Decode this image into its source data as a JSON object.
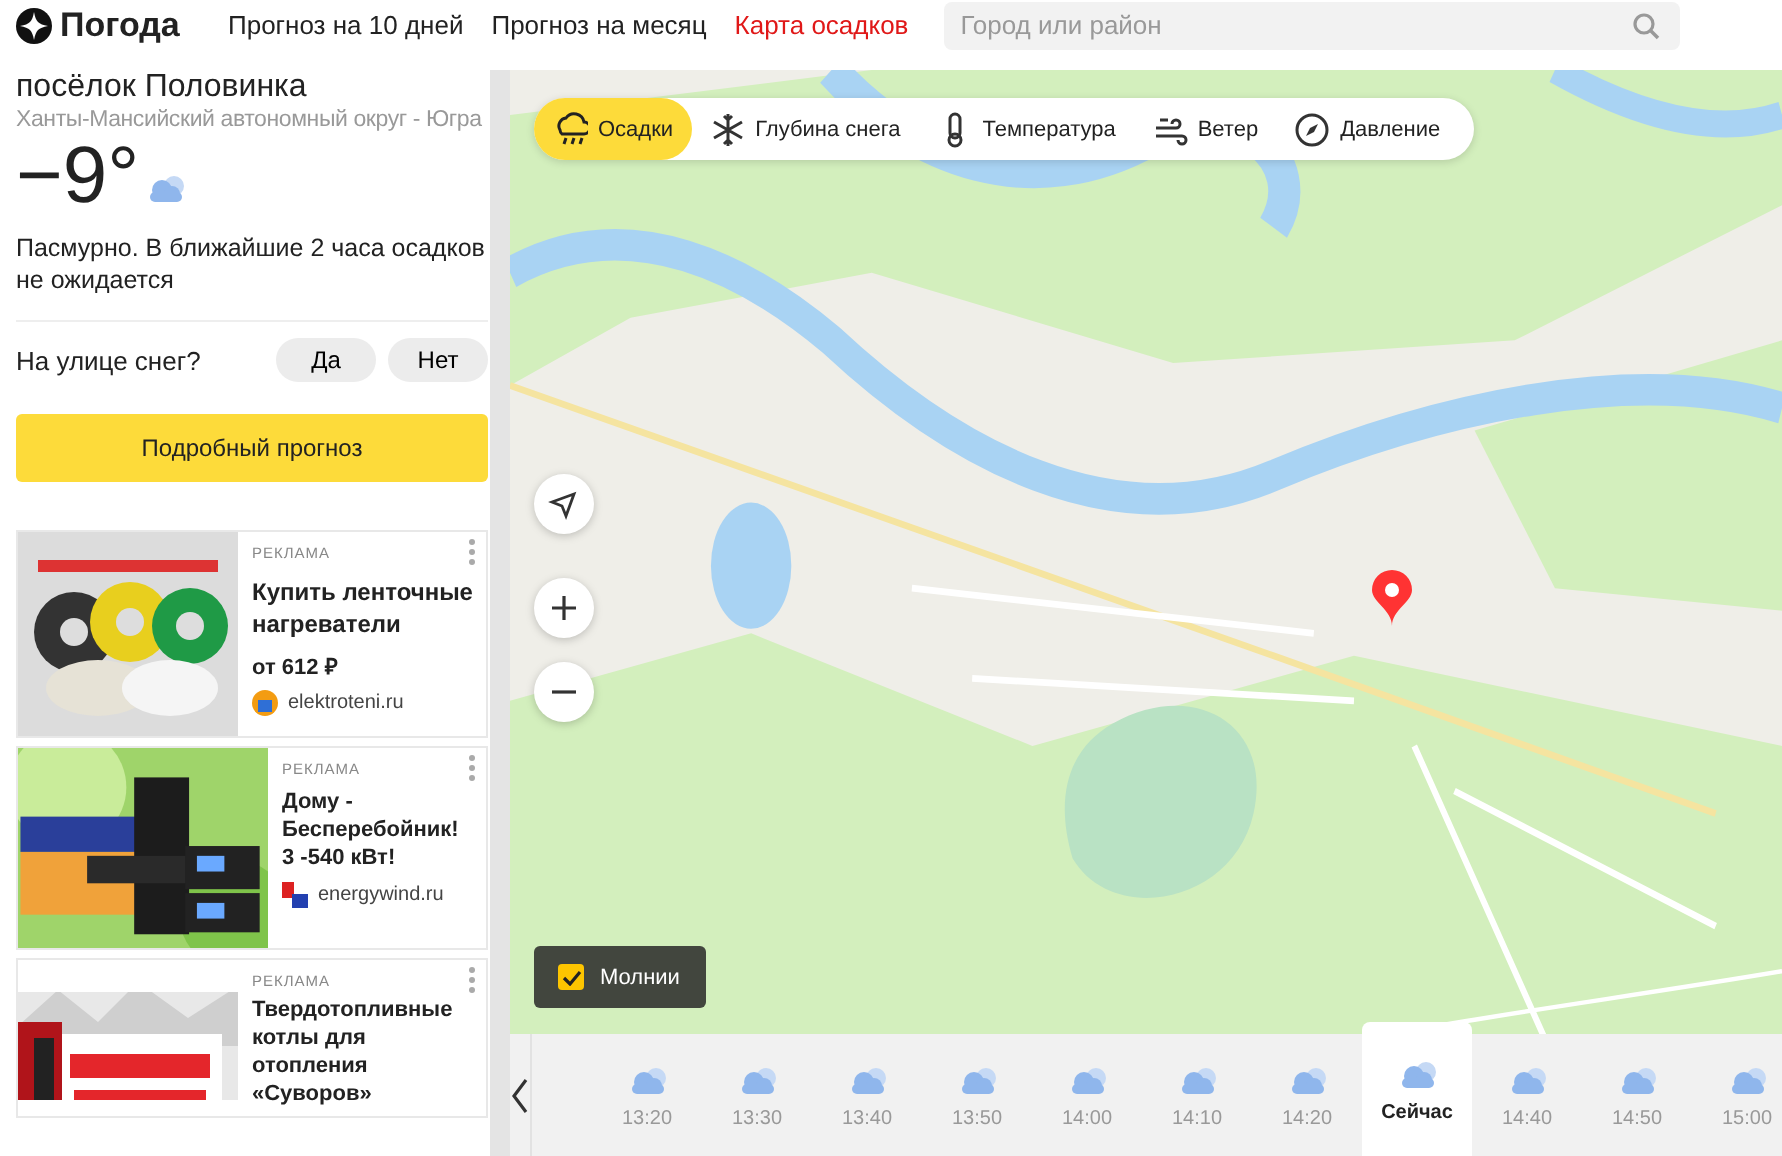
{
  "header": {
    "logo": "Погода",
    "nav": [
      {
        "label": "Прогноз на 10 дней",
        "selected": false
      },
      {
        "label": "Прогноз на месяц",
        "selected": false
      },
      {
        "label": "Карта осадков",
        "selected": true
      }
    ],
    "search": {
      "placeholder": "Город или район"
    }
  },
  "sidebar": {
    "location": "посёлок Половинка",
    "region": "Ханты-Мансийский автономный округ - Югра",
    "temperature": "−9°",
    "condition": "Пасмурно. В ближайшие 2 часа осадков не ожидается",
    "question": "На улице снег?",
    "answers": [
      "Да",
      "Нет"
    ],
    "button": "Подробный прогноз",
    "ads": [
      {
        "label": "РЕКЛАМА",
        "title": "Купить ленточные нагреватели",
        "price": "от 612 ₽",
        "domain": "elektroteni.ru",
        "kind": "reels"
      },
      {
        "label": "РЕКЛАМА",
        "title": "Дому - Бесперебойник! 3 -540 кВт!",
        "domain": "energywind.ru",
        "kind": "devices"
      },
      {
        "label": "РЕКЛАМА",
        "title": "Твердотопливные котлы для отопления «Суворов»",
        "kind": "boiler"
      }
    ]
  },
  "map": {
    "layers": [
      {
        "label": "Осадки",
        "kind": "rain",
        "selected": true
      },
      {
        "label": "Глубина снега",
        "kind": "snow",
        "selected": false
      },
      {
        "label": "Температура",
        "kind": "temperature",
        "selected": false
      },
      {
        "label": "Ветер",
        "kind": "wind",
        "selected": false
      },
      {
        "label": "Давление",
        "kind": "pressure",
        "selected": false
      }
    ],
    "lightning": {
      "label": "Молнии",
      "checked": true
    },
    "timeline": [
      {
        "time": "13:20",
        "selected": false
      },
      {
        "time": "13:30",
        "selected": false
      },
      {
        "time": "13:40",
        "selected": false
      },
      {
        "time": "13:50",
        "selected": false
      },
      {
        "time": "14:00",
        "selected": false
      },
      {
        "time": "14:10",
        "selected": false
      },
      {
        "time": "14:20",
        "selected": false
      },
      {
        "time": "Сейчас",
        "selected": true
      },
      {
        "time": "14:40",
        "selected": false
      },
      {
        "time": "14:50",
        "selected": false
      },
      {
        "time": "15:00",
        "selected": false
      }
    ]
  }
}
